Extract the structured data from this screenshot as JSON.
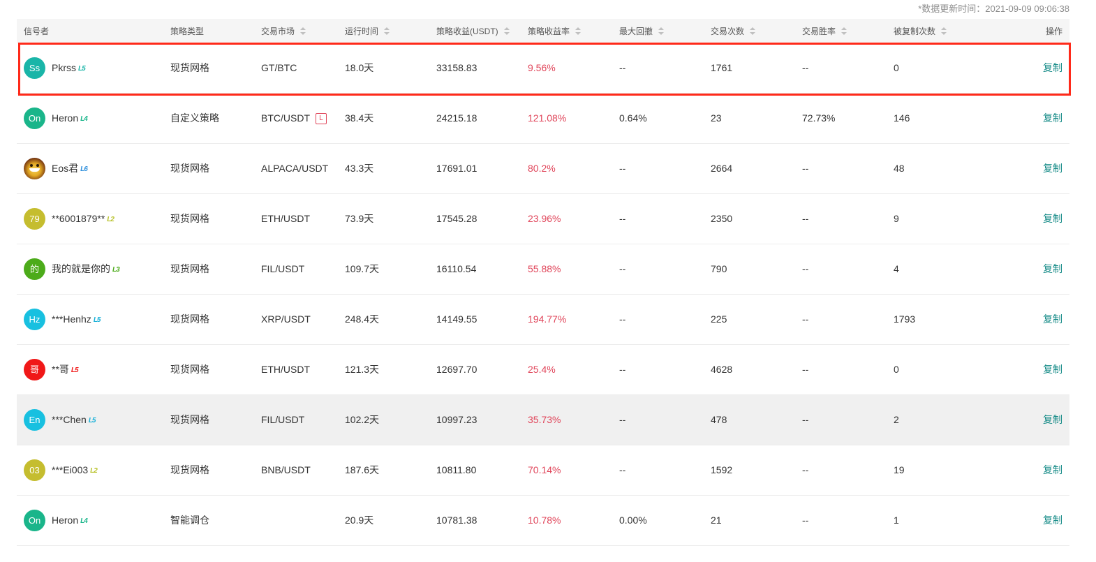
{
  "update_time": "*数据更新时间：2021-09-09 09:06:38",
  "columns": {
    "signaler": "信号者",
    "strategy_type": "策略类型",
    "market": "交易市场",
    "run_time": "运行时间",
    "profit": "策略收益(USDT)",
    "rate": "策略收益率",
    "drawdown": "最大回撤",
    "trades": "交易次数",
    "win_rate": "交易胜率",
    "copied": "被复制次数",
    "action": "操作"
  },
  "rows": [
    {
      "avatar": "Ss",
      "avatar_color": "#1ab5a8",
      "name": "Pkrss",
      "level": "L5",
      "level_color": "#1ab5a8",
      "type": "现货网格",
      "market": "GT/BTC",
      "tag": "",
      "time": "18.0天",
      "profit": "33158.83",
      "rate": "9.56%",
      "drawdown": "--",
      "trades": "1761",
      "win": "--",
      "copied": "0",
      "action": "复制"
    },
    {
      "avatar": "On",
      "avatar_color": "#1ab58a",
      "name": "Heron",
      "level": "L4",
      "level_color": "#1ab58a",
      "type": "自定义策略",
      "market": "BTC/USDT",
      "tag": "L",
      "time": "38.4天",
      "profit": "24215.18",
      "rate": "121.08%",
      "drawdown": "0.64%",
      "trades": "23",
      "win": "72.73%",
      "copied": "146",
      "action": "复制"
    },
    {
      "avatar": "",
      "avatar_color": "",
      "name": "Eos君",
      "level": "L6",
      "level_color": "#2e8fdc",
      "type": "现货网格",
      "market": "ALPACA/USDT",
      "tag": "",
      "time": "43.3天",
      "profit": "17691.01",
      "rate": "80.2%",
      "drawdown": "--",
      "trades": "2664",
      "win": "--",
      "copied": "48",
      "action": "复制"
    },
    {
      "avatar": "79",
      "avatar_color": "#c5bd2f",
      "name": "**6001879**",
      "level": "L2",
      "level_color": "#b8c22a",
      "type": "现货网格",
      "market": "ETH/USDT",
      "tag": "",
      "time": "73.9天",
      "profit": "17545.28",
      "rate": "23.96%",
      "drawdown": "--",
      "trades": "2350",
      "win": "--",
      "copied": "9",
      "action": "复制"
    },
    {
      "avatar": "的",
      "avatar_color": "#4cab1a",
      "name": "我的就是你的",
      "level": "L3",
      "level_color": "#4cab1a",
      "type": "现货网格",
      "market": "FIL/USDT",
      "tag": "",
      "time": "109.7天",
      "profit": "16110.54",
      "rate": "55.88%",
      "drawdown": "--",
      "trades": "790",
      "win": "--",
      "copied": "4",
      "action": "复制"
    },
    {
      "avatar": "Hz",
      "avatar_color": "#18c0e0",
      "name": "***Henhz",
      "level": "L5",
      "level_color": "#18b0d8",
      "type": "现货网格",
      "market": "XRP/USDT",
      "tag": "",
      "time": "248.4天",
      "profit": "14149.55",
      "rate": "194.77%",
      "drawdown": "--",
      "trades": "225",
      "win": "--",
      "copied": "1793",
      "action": "复制"
    },
    {
      "avatar": "哥",
      "avatar_color": "#f01818",
      "name": "**哥",
      "level": "L5",
      "level_color": "#f01818",
      "type": "现货网格",
      "market": "ETH/USDT",
      "tag": "",
      "time": "121.3天",
      "profit": "12697.70",
      "rate": "25.4%",
      "drawdown": "--",
      "trades": "4628",
      "win": "--",
      "copied": "0",
      "action": "复制"
    },
    {
      "avatar": "En",
      "avatar_color": "#18c0e0",
      "name": "***Chen",
      "level": "L5",
      "level_color": "#18b0d8",
      "type": "现货网格",
      "market": "FIL/USDT",
      "tag": "",
      "time": "102.2天",
      "profit": "10997.23",
      "rate": "35.73%",
      "drawdown": "--",
      "trades": "478",
      "win": "--",
      "copied": "2",
      "action": "复制"
    },
    {
      "avatar": "03",
      "avatar_color": "#c5bd2f",
      "name": "***Ei003",
      "level": "L2",
      "level_color": "#b8c22a",
      "type": "现货网格",
      "market": "BNB/USDT",
      "tag": "",
      "time": "187.6天",
      "profit": "10811.80",
      "rate": "70.14%",
      "drawdown": "--",
      "trades": "1592",
      "win": "--",
      "copied": "19",
      "action": "复制"
    },
    {
      "avatar": "On",
      "avatar_color": "#1ab58a",
      "name": "Heron",
      "level": "L4",
      "level_color": "#1ab58a",
      "type": "智能调仓",
      "market": "",
      "tag": "",
      "time": "20.9天",
      "profit": "10781.38",
      "rate": "10.78%",
      "drawdown": "0.00%",
      "trades": "21",
      "win": "--",
      "copied": "1",
      "action": "复制"
    }
  ],
  "hover_row_index": 7,
  "highlight_row_index": 0,
  "highlight_color": "#ff2a1a"
}
